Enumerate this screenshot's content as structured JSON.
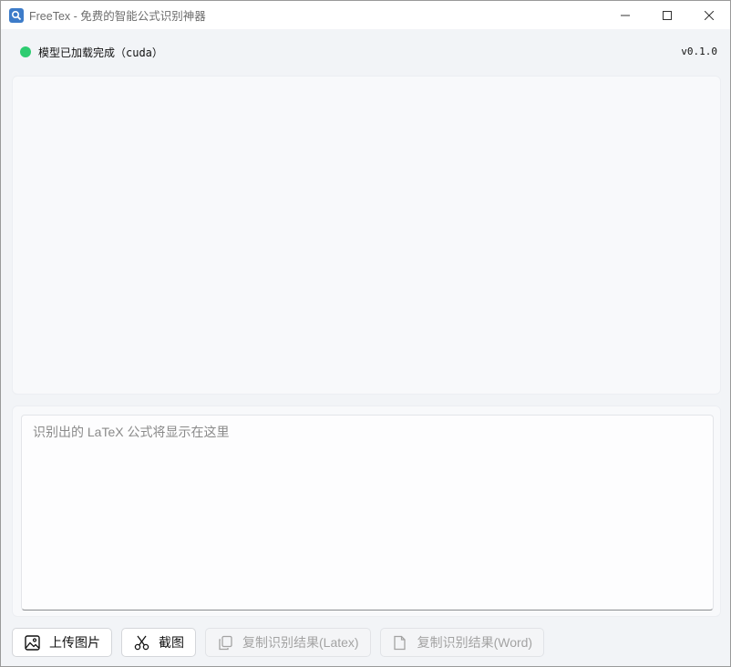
{
  "window": {
    "title": "FreeTex - 免费的智能公式识别神器",
    "icons": {
      "app": "magnifier-app-icon",
      "minimize": "minimize-icon",
      "maximize": "maximize-icon",
      "close": "close-icon"
    }
  },
  "status": {
    "text": "模型已加载完成（cuda）",
    "color": "#2ecc71",
    "version": "v0.1.0"
  },
  "result": {
    "placeholder": "识别出的 LaTeX 公式将显示在这里",
    "value": ""
  },
  "toolbar": {
    "upload_label": "上传图片",
    "screenshot_label": "截图",
    "copy_latex_label": "复制识别结果(Latex)",
    "copy_word_label": "复制识别结果(Word)"
  }
}
